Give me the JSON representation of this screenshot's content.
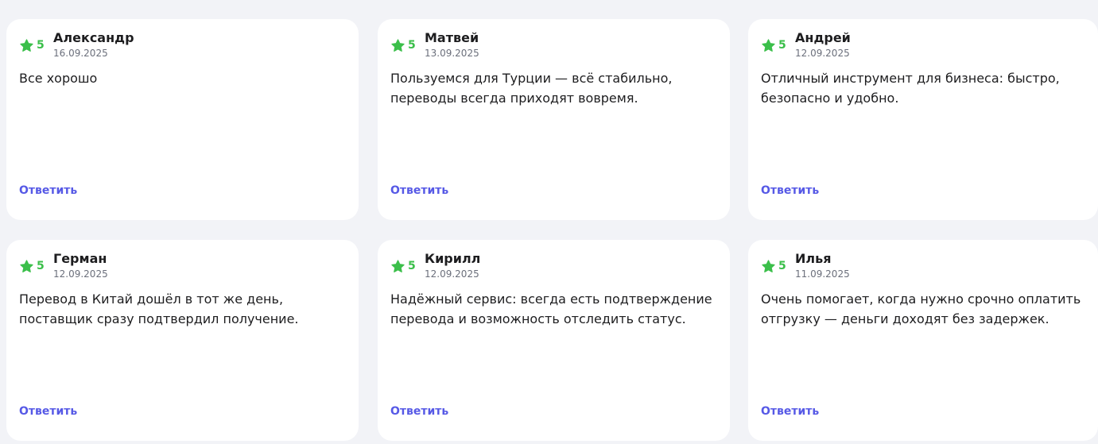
{
  "accent_color": "#5659e6",
  "rating_color": "#3bbf4a",
  "reviews": [
    {
      "rating": "5",
      "author": "Александр",
      "date": "16.09.2025",
      "text": "Все хорошо",
      "reply_label": "Ответить"
    },
    {
      "rating": "5",
      "author": "Матвей",
      "date": "13.09.2025",
      "text": "Пользуемся для Турции — всё стабильно, переводы всегда приходят вовремя.",
      "reply_label": "Ответить"
    },
    {
      "rating": "5",
      "author": "Андрей",
      "date": "12.09.2025",
      "text": "Отличный инструмент для бизнеса: быстро, безопасно и удобно.",
      "reply_label": "Ответить"
    },
    {
      "rating": "5",
      "author": "Герман",
      "date": "12.09.2025",
      "text": "Перевод в Китай дошёл в тот же день, поставщик сразу подтвердил получение.",
      "reply_label": "Ответить"
    },
    {
      "rating": "5",
      "author": "Кирилл",
      "date": "12.09.2025",
      "text": "Надёжный сервис: всегда есть подтверждение перевода и возможность отследить статус.",
      "reply_label": "Ответить"
    },
    {
      "rating": "5",
      "author": "Илья",
      "date": "11.09.2025",
      "text": "Очень помогает, когда нужно срочно оплатить отгрузку — деньги доходят без задержек.",
      "reply_label": "Ответить"
    }
  ]
}
